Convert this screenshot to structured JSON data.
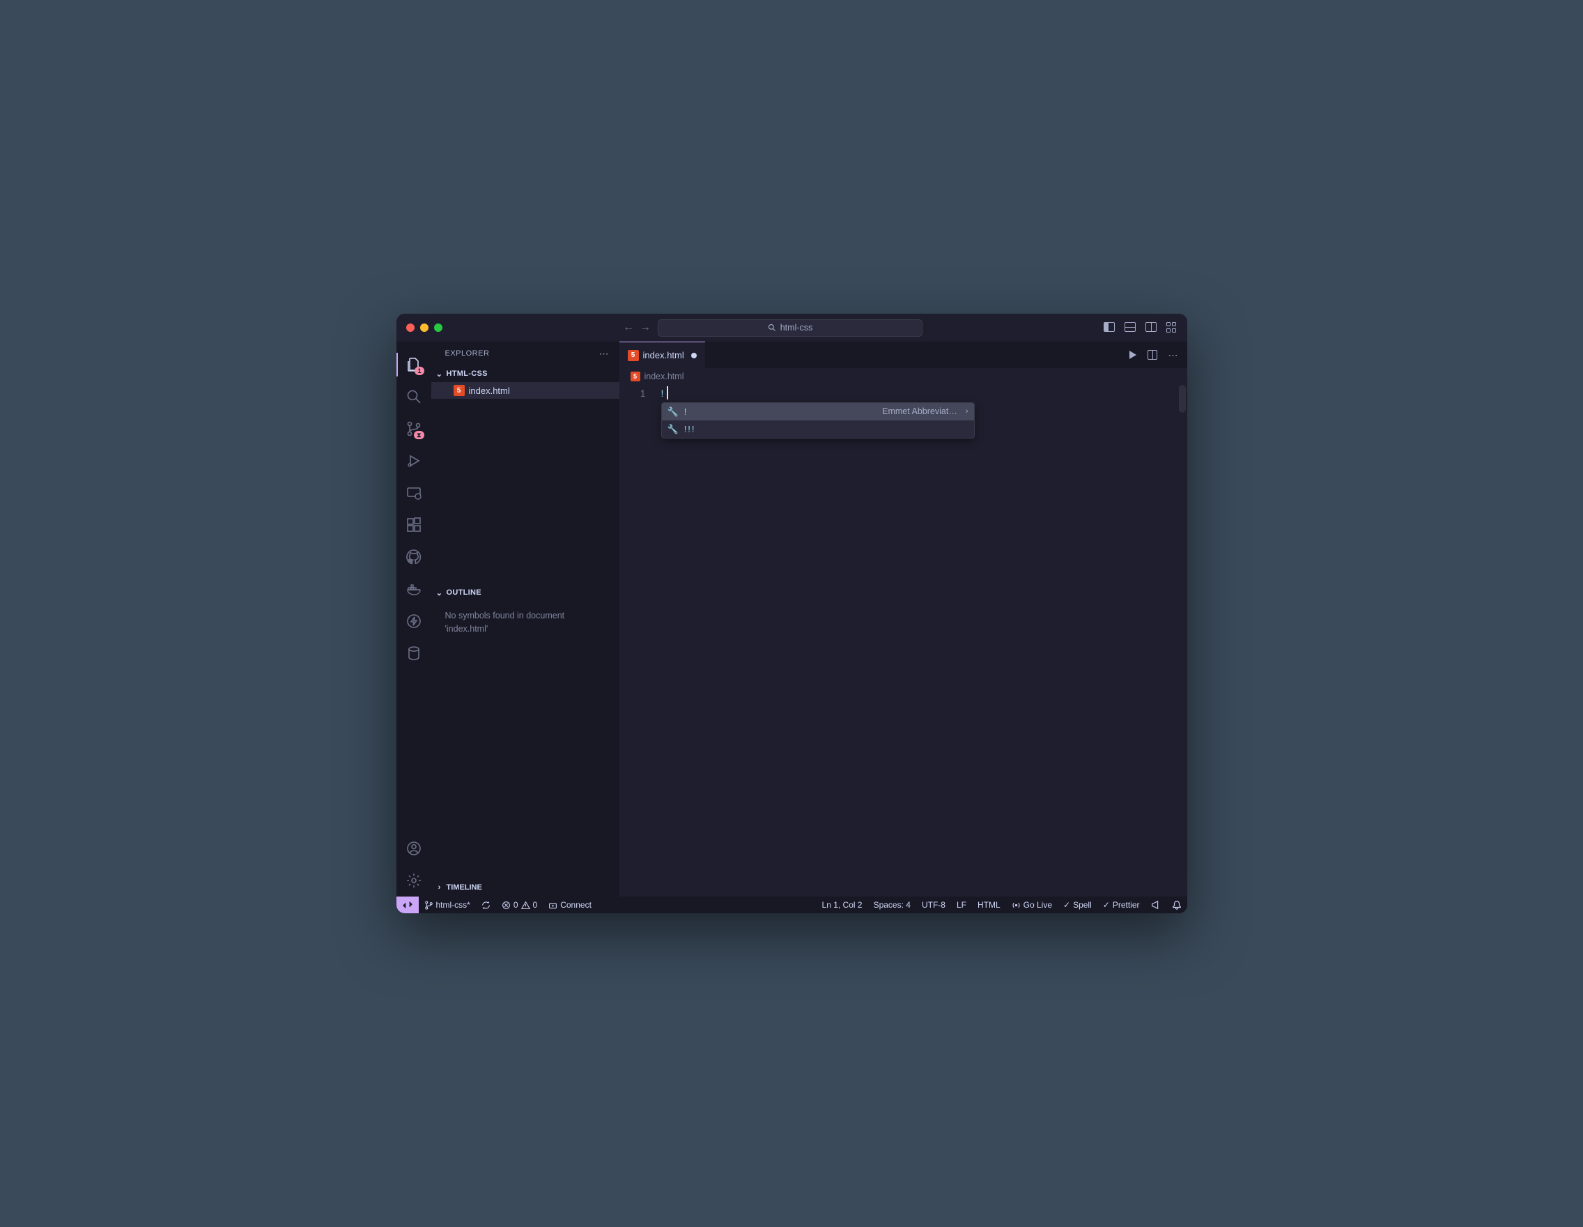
{
  "title_search": "html-css",
  "sidebar": {
    "title": "EXPLORER",
    "folder": "HTML-CSS",
    "files": [
      {
        "name": "index.html"
      }
    ],
    "outline_title": "OUTLINE",
    "outline_msg": "No symbols found in document 'index.html'",
    "timeline_title": "TIMELINE"
  },
  "activity_badge": "1",
  "tab": {
    "label": "index.html"
  },
  "breadcrumb": "index.html",
  "editor": {
    "line_number": "1",
    "content": "!"
  },
  "suggest": {
    "items": [
      {
        "label": "!",
        "desc": "Emmet Abbreviat…"
      },
      {
        "label": "!!!",
        "desc": ""
      }
    ]
  },
  "status": {
    "branch": "html-css*",
    "errors": "0",
    "warnings": "0",
    "connect": "Connect",
    "cursor": "Ln 1, Col 2",
    "spaces": "Spaces: 4",
    "encoding": "UTF-8",
    "eol": "LF",
    "lang": "HTML",
    "golive": "Go Live",
    "spell": "Spell",
    "prettier": "Prettier"
  }
}
